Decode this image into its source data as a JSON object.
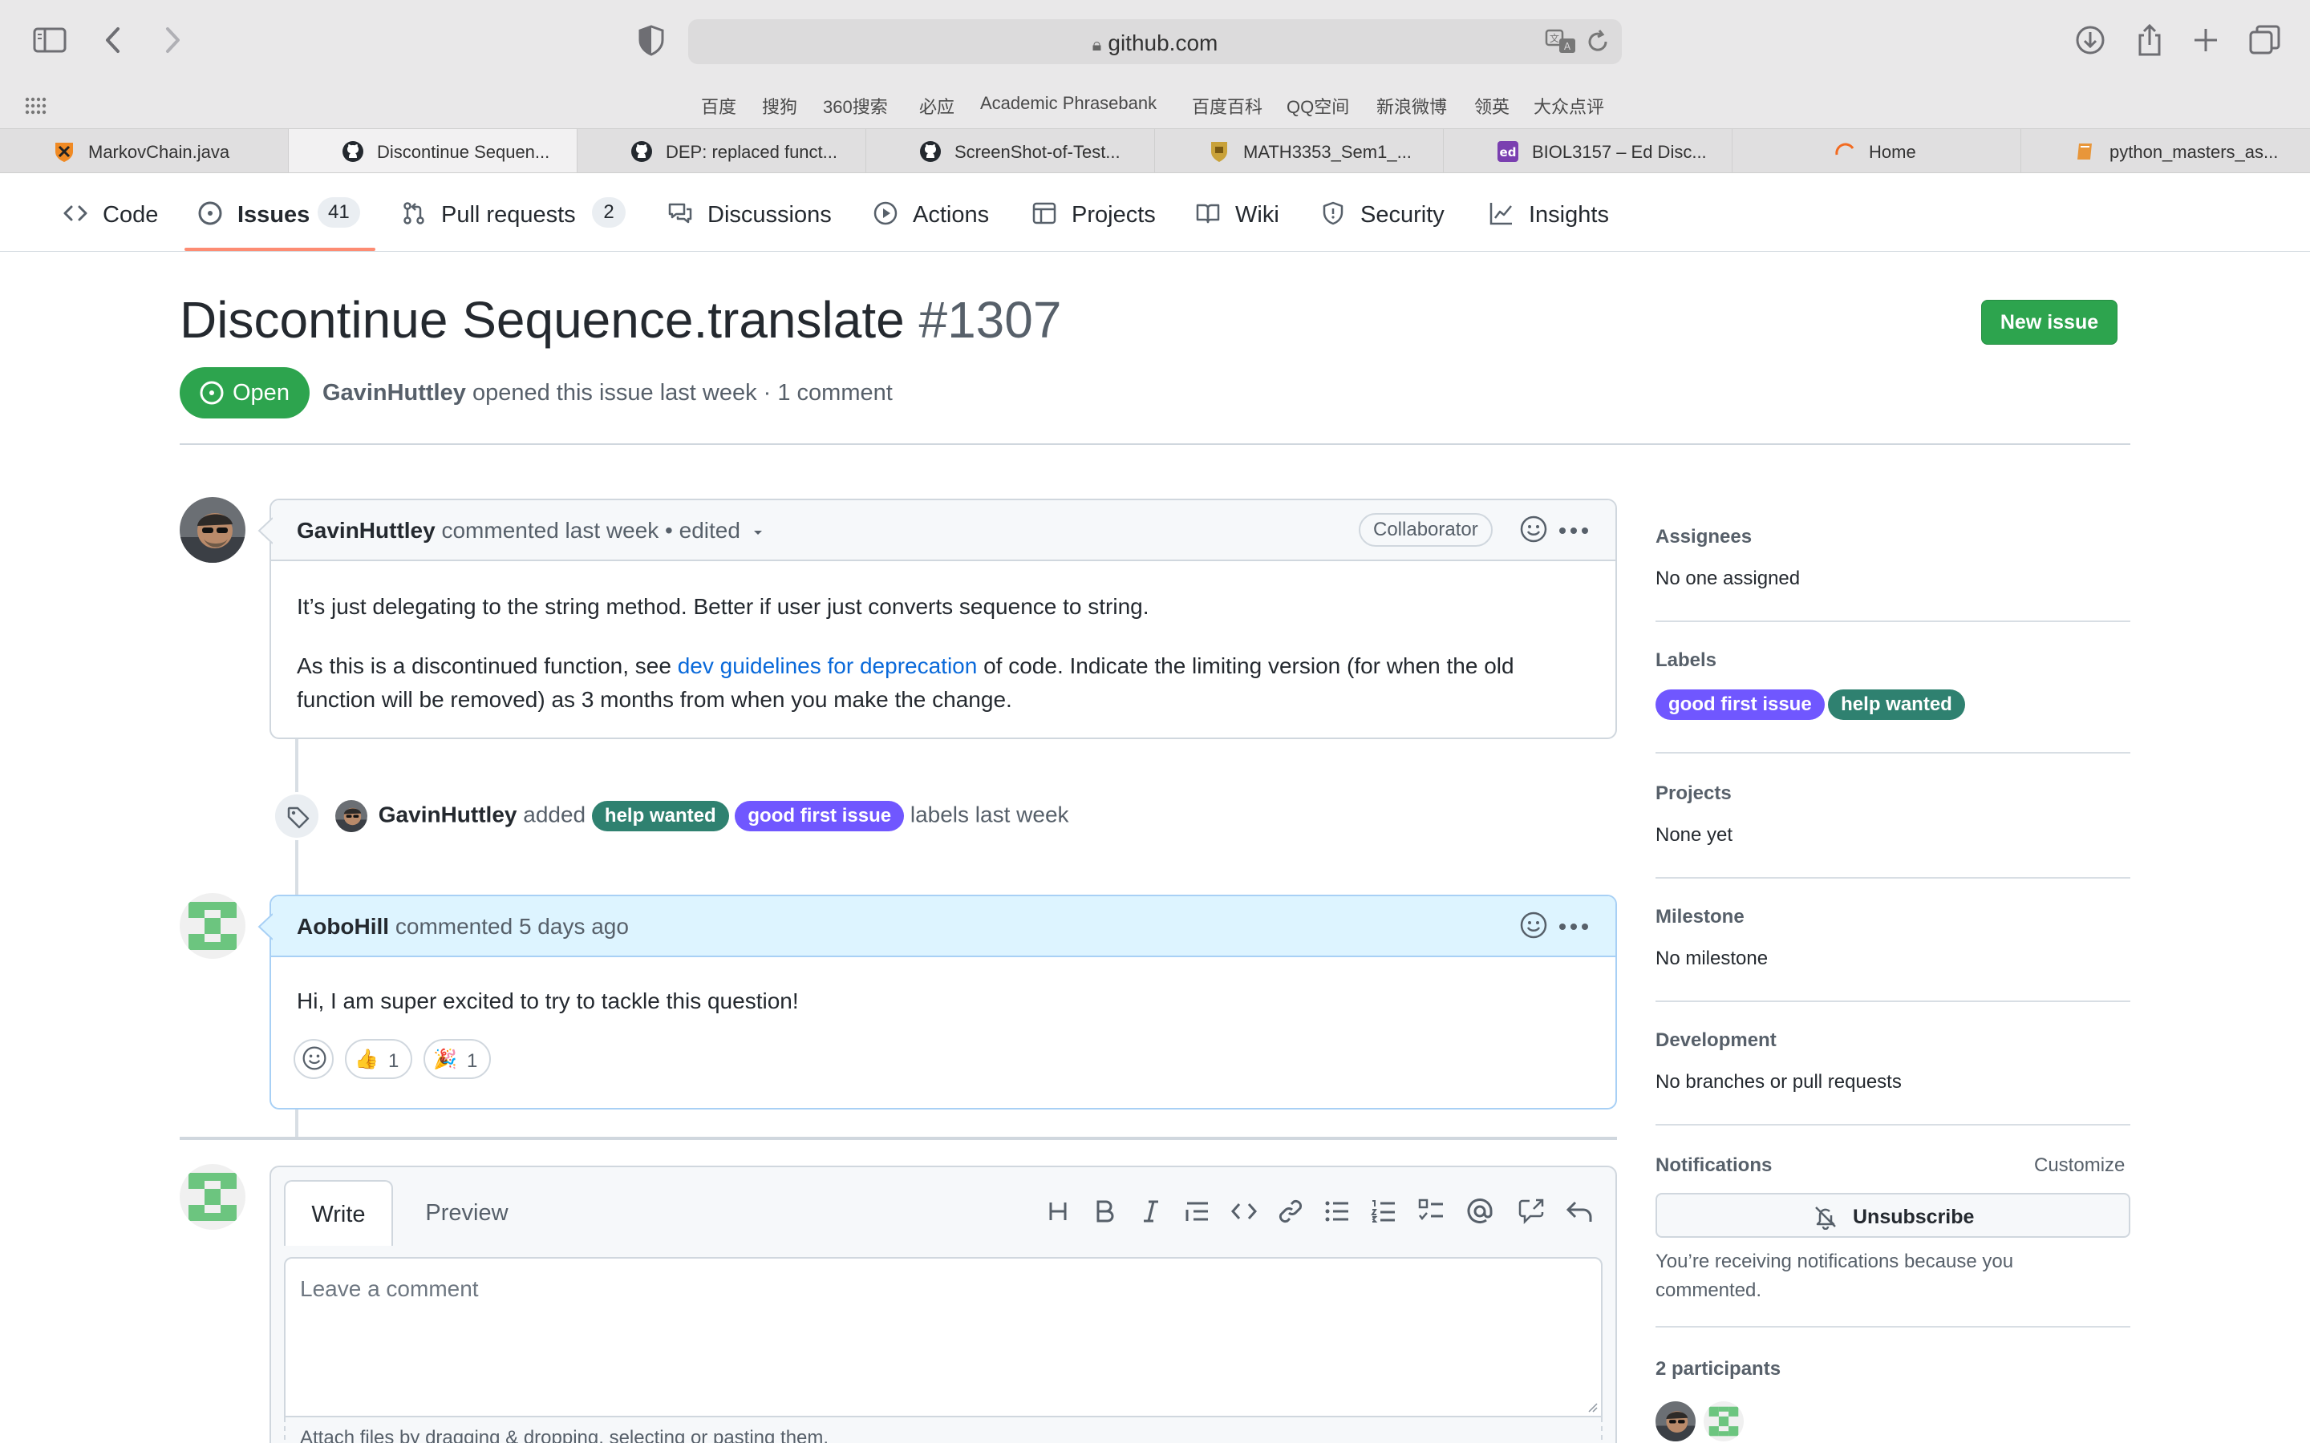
{
  "browser": {
    "url": "github.com",
    "favorites": [
      "百度",
      "搜狗",
      "360搜索",
      "必应",
      "Academic Phrasebank",
      "百度百科",
      "QQ空间",
      "新浪微博",
      "领英",
      "大众点评"
    ],
    "tabs": [
      {
        "title": "MarkovChain.java",
        "active": false
      },
      {
        "title": "Discontinue Sequen...",
        "active": true
      },
      {
        "title": "DEP: replaced funct...",
        "active": false
      },
      {
        "title": "ScreenShot-of-Test...",
        "active": false
      },
      {
        "title": "MATH3353_Sem1_...",
        "active": false
      },
      {
        "title": "BIOL3157 – Ed Disc...",
        "active": false
      },
      {
        "title": "Home",
        "active": false
      },
      {
        "title": "python_masters_as...",
        "active": false
      }
    ]
  },
  "repo_nav": {
    "code": "Code",
    "issues": "Issues",
    "issues_count": "41",
    "pulls": "Pull requests",
    "pulls_count": "2",
    "discussions": "Discussions",
    "actions": "Actions",
    "projects": "Projects",
    "wiki": "Wiki",
    "security": "Security",
    "insights": "Insights"
  },
  "issue": {
    "title": "Discontinue Sequence.translate",
    "number": "#1307",
    "state": "Open",
    "author": "GavinHuttley",
    "meta": "opened this issue last week · 1 comment",
    "new_issue_label": "New issue"
  },
  "comments": [
    {
      "author": "GavinHuttley",
      "meta": "commented last week • edited",
      "role": "Collaborator",
      "body_p1": "It’s just delegating to the string method. Better if user just converts sequence to string.",
      "body_p2_pre": "As this is a discontinued function, see ",
      "body_p2_link": "dev guidelines for deprecation",
      "body_p2_post": " of code. Indicate the limiting version (for when the old",
      "body_p2_line2": "function will be removed) as 3 months from when you make the change."
    },
    {
      "author": "AoboHill",
      "meta": "commented 5 days ago",
      "body": "Hi, I am super excited to try to tackle this question!",
      "reactions": [
        {
          "emoji": "👍",
          "count": "1"
        },
        {
          "emoji": "🎉",
          "count": "1"
        }
      ]
    }
  ],
  "label_event": {
    "actor": "GavinHuttley",
    "verb": "added",
    "labels": [
      "help wanted",
      "good first issue"
    ],
    "suffix": "labels last week"
  },
  "editor": {
    "write_tab": "Write",
    "preview_tab": "Preview",
    "placeholder": "Leave a comment",
    "attach_hint": "Attach files by dragging & dropping, selecting or pasting them."
  },
  "sidebar": {
    "assignees_h": "Assignees",
    "assignees_v": "No one assigned",
    "labels_h": "Labels",
    "labels": [
      "good first issue",
      "help wanted"
    ],
    "projects_h": "Projects",
    "projects_v": "None yet",
    "milestone_h": "Milestone",
    "milestone_v": "No milestone",
    "development_h": "Development",
    "development_v": "No branches or pull requests",
    "notifications_h": "Notifications",
    "customize": "Customize",
    "unsubscribe": "Unsubscribe",
    "notif_reason": "You’re receiving notifications because you commented.",
    "participants_h": "2 participants"
  },
  "colors": {
    "open_green": "#2da44e",
    "help_wanted": "#2f8170",
    "good_first_issue": "#7057ff",
    "link": "#0969da",
    "tab_underline": "#fd8c73"
  }
}
